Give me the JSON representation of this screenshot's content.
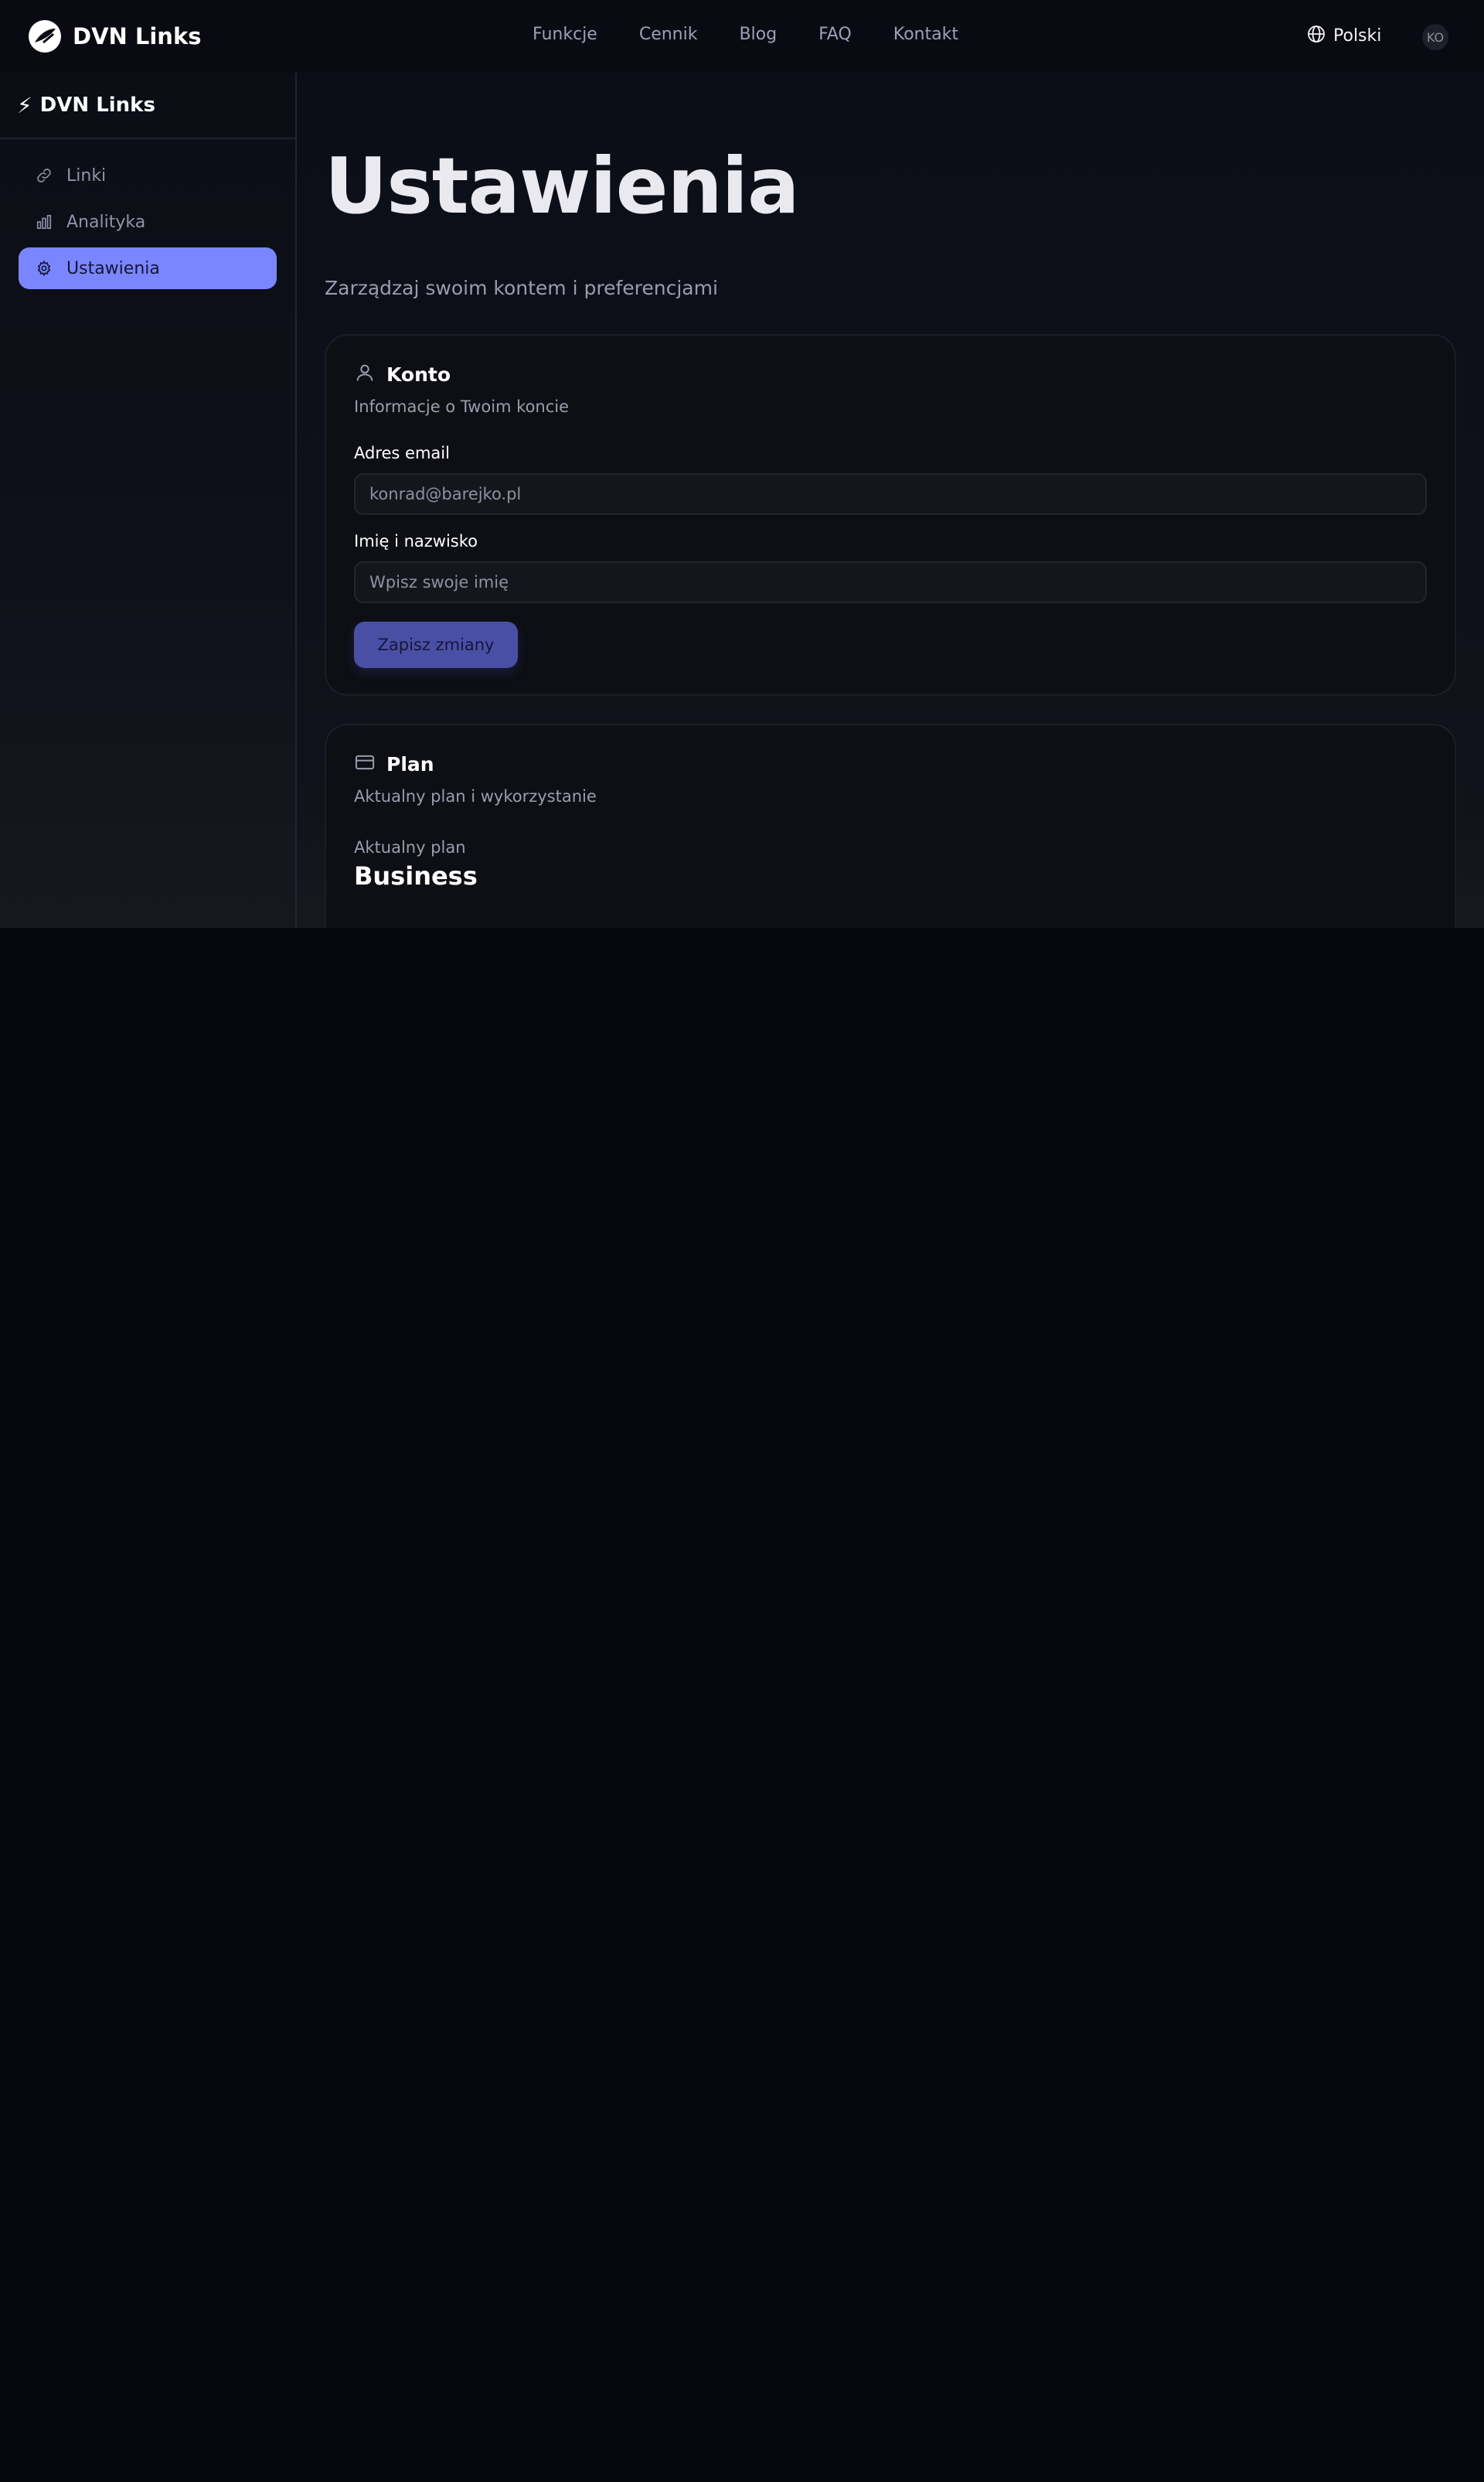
{
  "brand": {
    "name": "DVN Links"
  },
  "nav": {
    "links": [
      "Funkcje",
      "Cennik",
      "Blog",
      "FAQ",
      "Kontakt"
    ],
    "language": "Polski",
    "avatar_initials": "KO"
  },
  "sidebar": {
    "title": "DVN Links",
    "items": [
      {
        "label": "Linki",
        "icon": "link-icon"
      },
      {
        "label": "Analityka",
        "icon": "bar-chart-icon"
      },
      {
        "label": "Ustawienia",
        "icon": "gear-icon",
        "active": true
      }
    ]
  },
  "page": {
    "title": "Ustawienia",
    "subtitle": "Zarządzaj swoim kontem i preferencjami"
  },
  "account_card": {
    "title": "Konto",
    "description": "Informacje o Twoim koncie",
    "email_label": "Adres email",
    "email_value": "konrad@barejko.pl",
    "name_label": "Imię i nazwisko",
    "name_placeholder": "Wpisz swoje imię",
    "save_label": "Zapisz zmiany"
  },
  "plan_card": {
    "title": "Plan",
    "description": "Aktualny plan i wykorzystanie",
    "current_plan_label": "Aktualny plan",
    "current_plan_value": "Business"
  },
  "colors": {
    "accent": "#7a86ff",
    "save_button": "#4a4fa6",
    "background": "#07080d"
  }
}
